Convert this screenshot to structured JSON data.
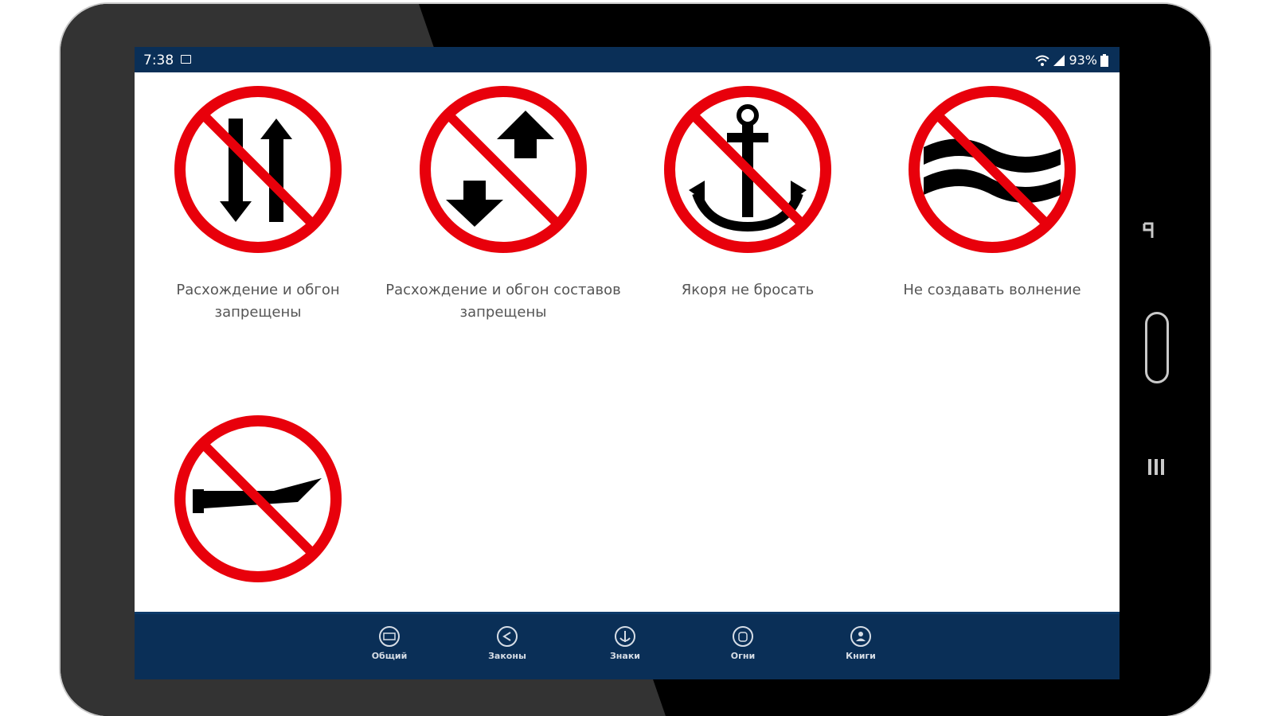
{
  "statusbar": {
    "time": "7:38",
    "battery": "93%"
  },
  "signs": [
    {
      "label": "Расхождение и обгон запрещены",
      "icon": "no-passing-arrows-icon"
    },
    {
      "label": "Расхождение и обгон составов запрещены",
      "icon": "no-passing-convoys-icon"
    },
    {
      "label": "Якоря не бросать",
      "icon": "no-anchoring-icon"
    },
    {
      "label": "Не создавать волнение",
      "icon": "no-waves-icon"
    },
    {
      "label": "",
      "icon": "no-motorboat-icon"
    }
  ],
  "nav": [
    {
      "label": "Общий",
      "icon": "general-icon"
    },
    {
      "label": "Законы",
      "icon": "laws-icon"
    },
    {
      "label": "Знаки",
      "icon": "signs-icon"
    },
    {
      "label": "Огни",
      "icon": "lights-icon"
    },
    {
      "label": "Книги",
      "icon": "books-icon"
    }
  ],
  "colors": {
    "bar": "#0a2f57",
    "prohibition_red": "#e8000b",
    "symbol": "#000000",
    "bezel": "#000000"
  }
}
